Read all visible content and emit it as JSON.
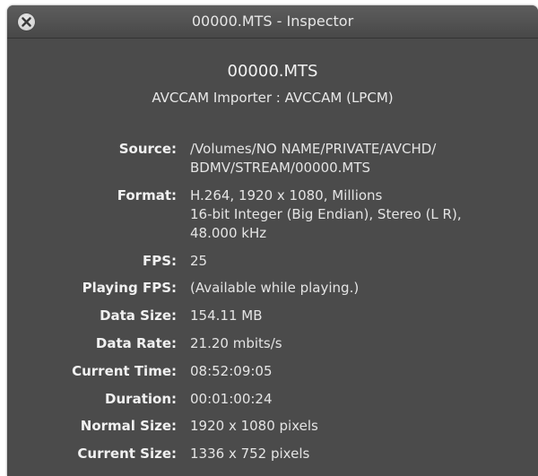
{
  "window": {
    "title": "00000.MTS - Inspector"
  },
  "header": {
    "filename": "00000.MTS",
    "importer": "AVCCAM Importer : AVCCAM (LPCM)"
  },
  "properties": [
    {
      "label": "Source:",
      "value": "/Volumes/NO NAME/PRIVATE/AVCHD/\nBDMV/STREAM/00000.MTS"
    },
    {
      "label": "Format:",
      "value": "H.264, 1920 x 1080, Millions\n16-bit Integer (Big Endian), Stereo (L R),\n48.000 kHz"
    },
    {
      "label": "FPS:",
      "value": "25"
    },
    {
      "label": "Playing FPS:",
      "value": "(Available while playing.)"
    },
    {
      "label": "Data Size:",
      "value": "154.11 MB"
    },
    {
      "label": "Data Rate:",
      "value": "21.20 mbits/s"
    },
    {
      "label": "Current Time:",
      "value": "08:52:09:05"
    },
    {
      "label": "Duration:",
      "value": "00:01:00:24"
    },
    {
      "label": "Normal Size:",
      "value": "1920 x 1080 pixels"
    },
    {
      "label": "Current Size:",
      "value": "1336 x 752 pixels"
    }
  ],
  "colors": {
    "window_background": "#4b4b4b",
    "text": "#e4e4e4"
  }
}
